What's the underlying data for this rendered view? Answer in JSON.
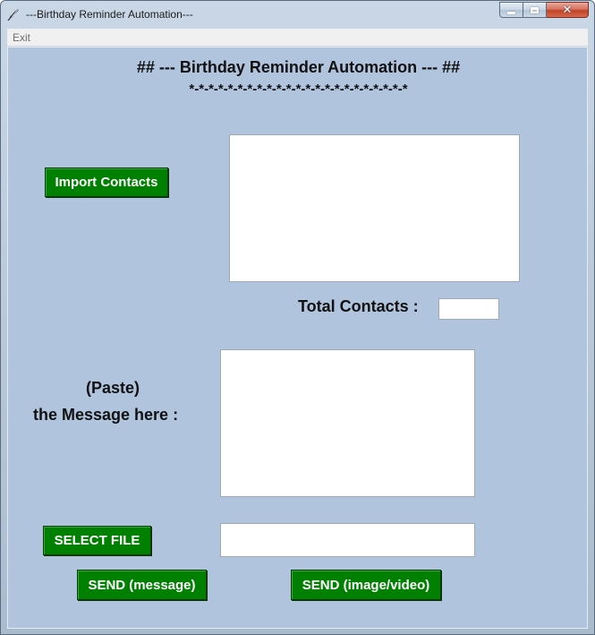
{
  "window": {
    "title": "---Birthday Reminder Automation---",
    "minimize": "–",
    "maximize": "□",
    "close": "✕"
  },
  "menu": {
    "exit_label": "Exit"
  },
  "main": {
    "heading": "## --- Birthday Reminder Automation --- ##",
    "stars": "*-*-*-*-*-*-*-*-*-*-*-*-*-*-*-*-*-*-*-*-*-*-*",
    "import_button": "Import Contacts",
    "contacts_box_value": "",
    "total_contacts_label": "Total Contacts :",
    "total_contacts_value": "",
    "paste_label_line1": "(Paste)",
    "paste_label_line2": "the Message here :",
    "message_value": "",
    "select_file_button": "SELECT FILE",
    "file_path_value": "",
    "send_message_button": "SEND (message)",
    "send_media_button": "SEND (image/video)"
  },
  "colors": {
    "client_background": "#b0c4de",
    "button_green": "#008000"
  }
}
